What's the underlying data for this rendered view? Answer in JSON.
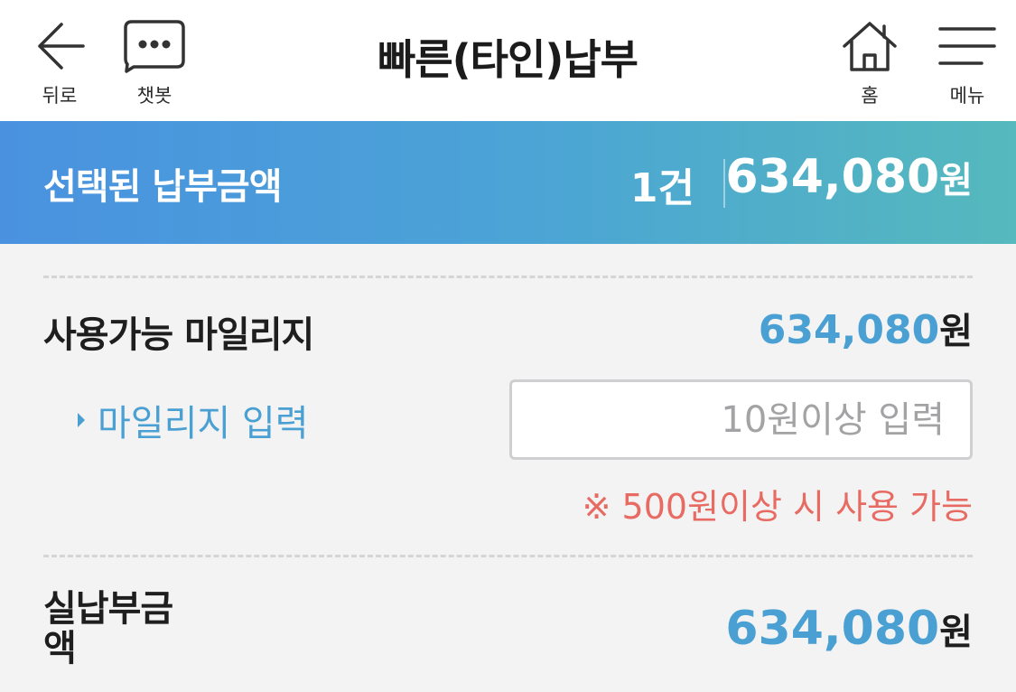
{
  "header": {
    "title": "빠른(타인)납부",
    "back_label": "뒤로",
    "chatbot_label": "챗봇",
    "home_label": "홈",
    "menu_label": "메뉴"
  },
  "summary": {
    "label": "선택된 납부금액",
    "count": "1건",
    "amount": "634,080",
    "unit": "원"
  },
  "mileage": {
    "label": "사용가능 마일리지",
    "value": "634,080",
    "unit": "원",
    "input_link": "마일리지 입력",
    "input_placeholder": "10원이상 입력",
    "input_value": "",
    "notice": "※ 500원이상 시 사용 가능"
  },
  "final": {
    "label": "실납부금액",
    "value": "634,080",
    "unit": "원"
  },
  "colors": {
    "accent_blue": "#4aa0d2",
    "notice_red": "#e86b63",
    "band_start": "#4a92e0",
    "band_end": "#55b9bd"
  },
  "icons": [
    "arrow-left-icon",
    "chat-bubble-icon",
    "home-icon",
    "hamburger-menu-icon"
  ]
}
